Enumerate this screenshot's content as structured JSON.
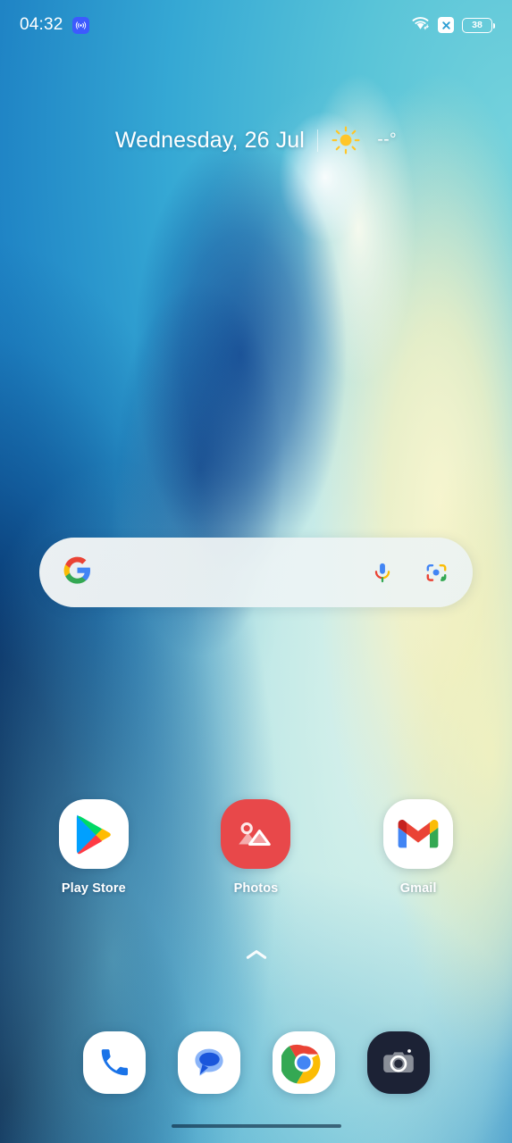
{
  "status_bar": {
    "time": "04:32",
    "cast_badge_icon": "broadcast-icon",
    "wifi_icon": "wifi-icon",
    "no_sim_icon": "no-sim-x-icon",
    "battery_level": "38",
    "battery_icon": "battery-icon",
    "accent_badge_color": "#3d5afe"
  },
  "date_widget": {
    "date": "Wednesday, 26 Jul",
    "weather_icon": "sun-icon",
    "temperature": "--°",
    "sun_color": "#ffc629"
  },
  "search": {
    "value": "",
    "placeholder": "",
    "google_icon": "google-g-icon",
    "mic_icon": "microphone-icon",
    "lens_icon": "google-lens-icon",
    "bar_color": "#f1f4f4"
  },
  "apps": [
    {
      "label": "Play Store",
      "icon": "play-store-icon",
      "bg": "#ffffff"
    },
    {
      "label": "Photos",
      "icon": "photos-gallery-icon",
      "bg": "#e8484a"
    },
    {
      "label": "Gmail",
      "icon": "gmail-icon",
      "bg": "#ffffff"
    }
  ],
  "drawer": {
    "chevron_icon": "chevron-up-icon"
  },
  "dock": [
    {
      "label": "Phone",
      "icon": "phone-icon",
      "bg": "#ffffff"
    },
    {
      "label": "Messages",
      "icon": "messages-icon",
      "bg": "#ffffff"
    },
    {
      "label": "Chrome",
      "icon": "chrome-icon",
      "bg": "#ffffff"
    },
    {
      "label": "Camera",
      "icon": "camera-icon",
      "bg": "#1c2235"
    }
  ],
  "nav_bar": {
    "handle_icon": "gesture-handle"
  },
  "wallpaper": {
    "description": "abstract blue-teal curved petal gradient",
    "colors": [
      "#0a2a5e",
      "#1f84c5",
      "#59c4d8",
      "#bfe8e6",
      "#f7f2ba"
    ]
  }
}
